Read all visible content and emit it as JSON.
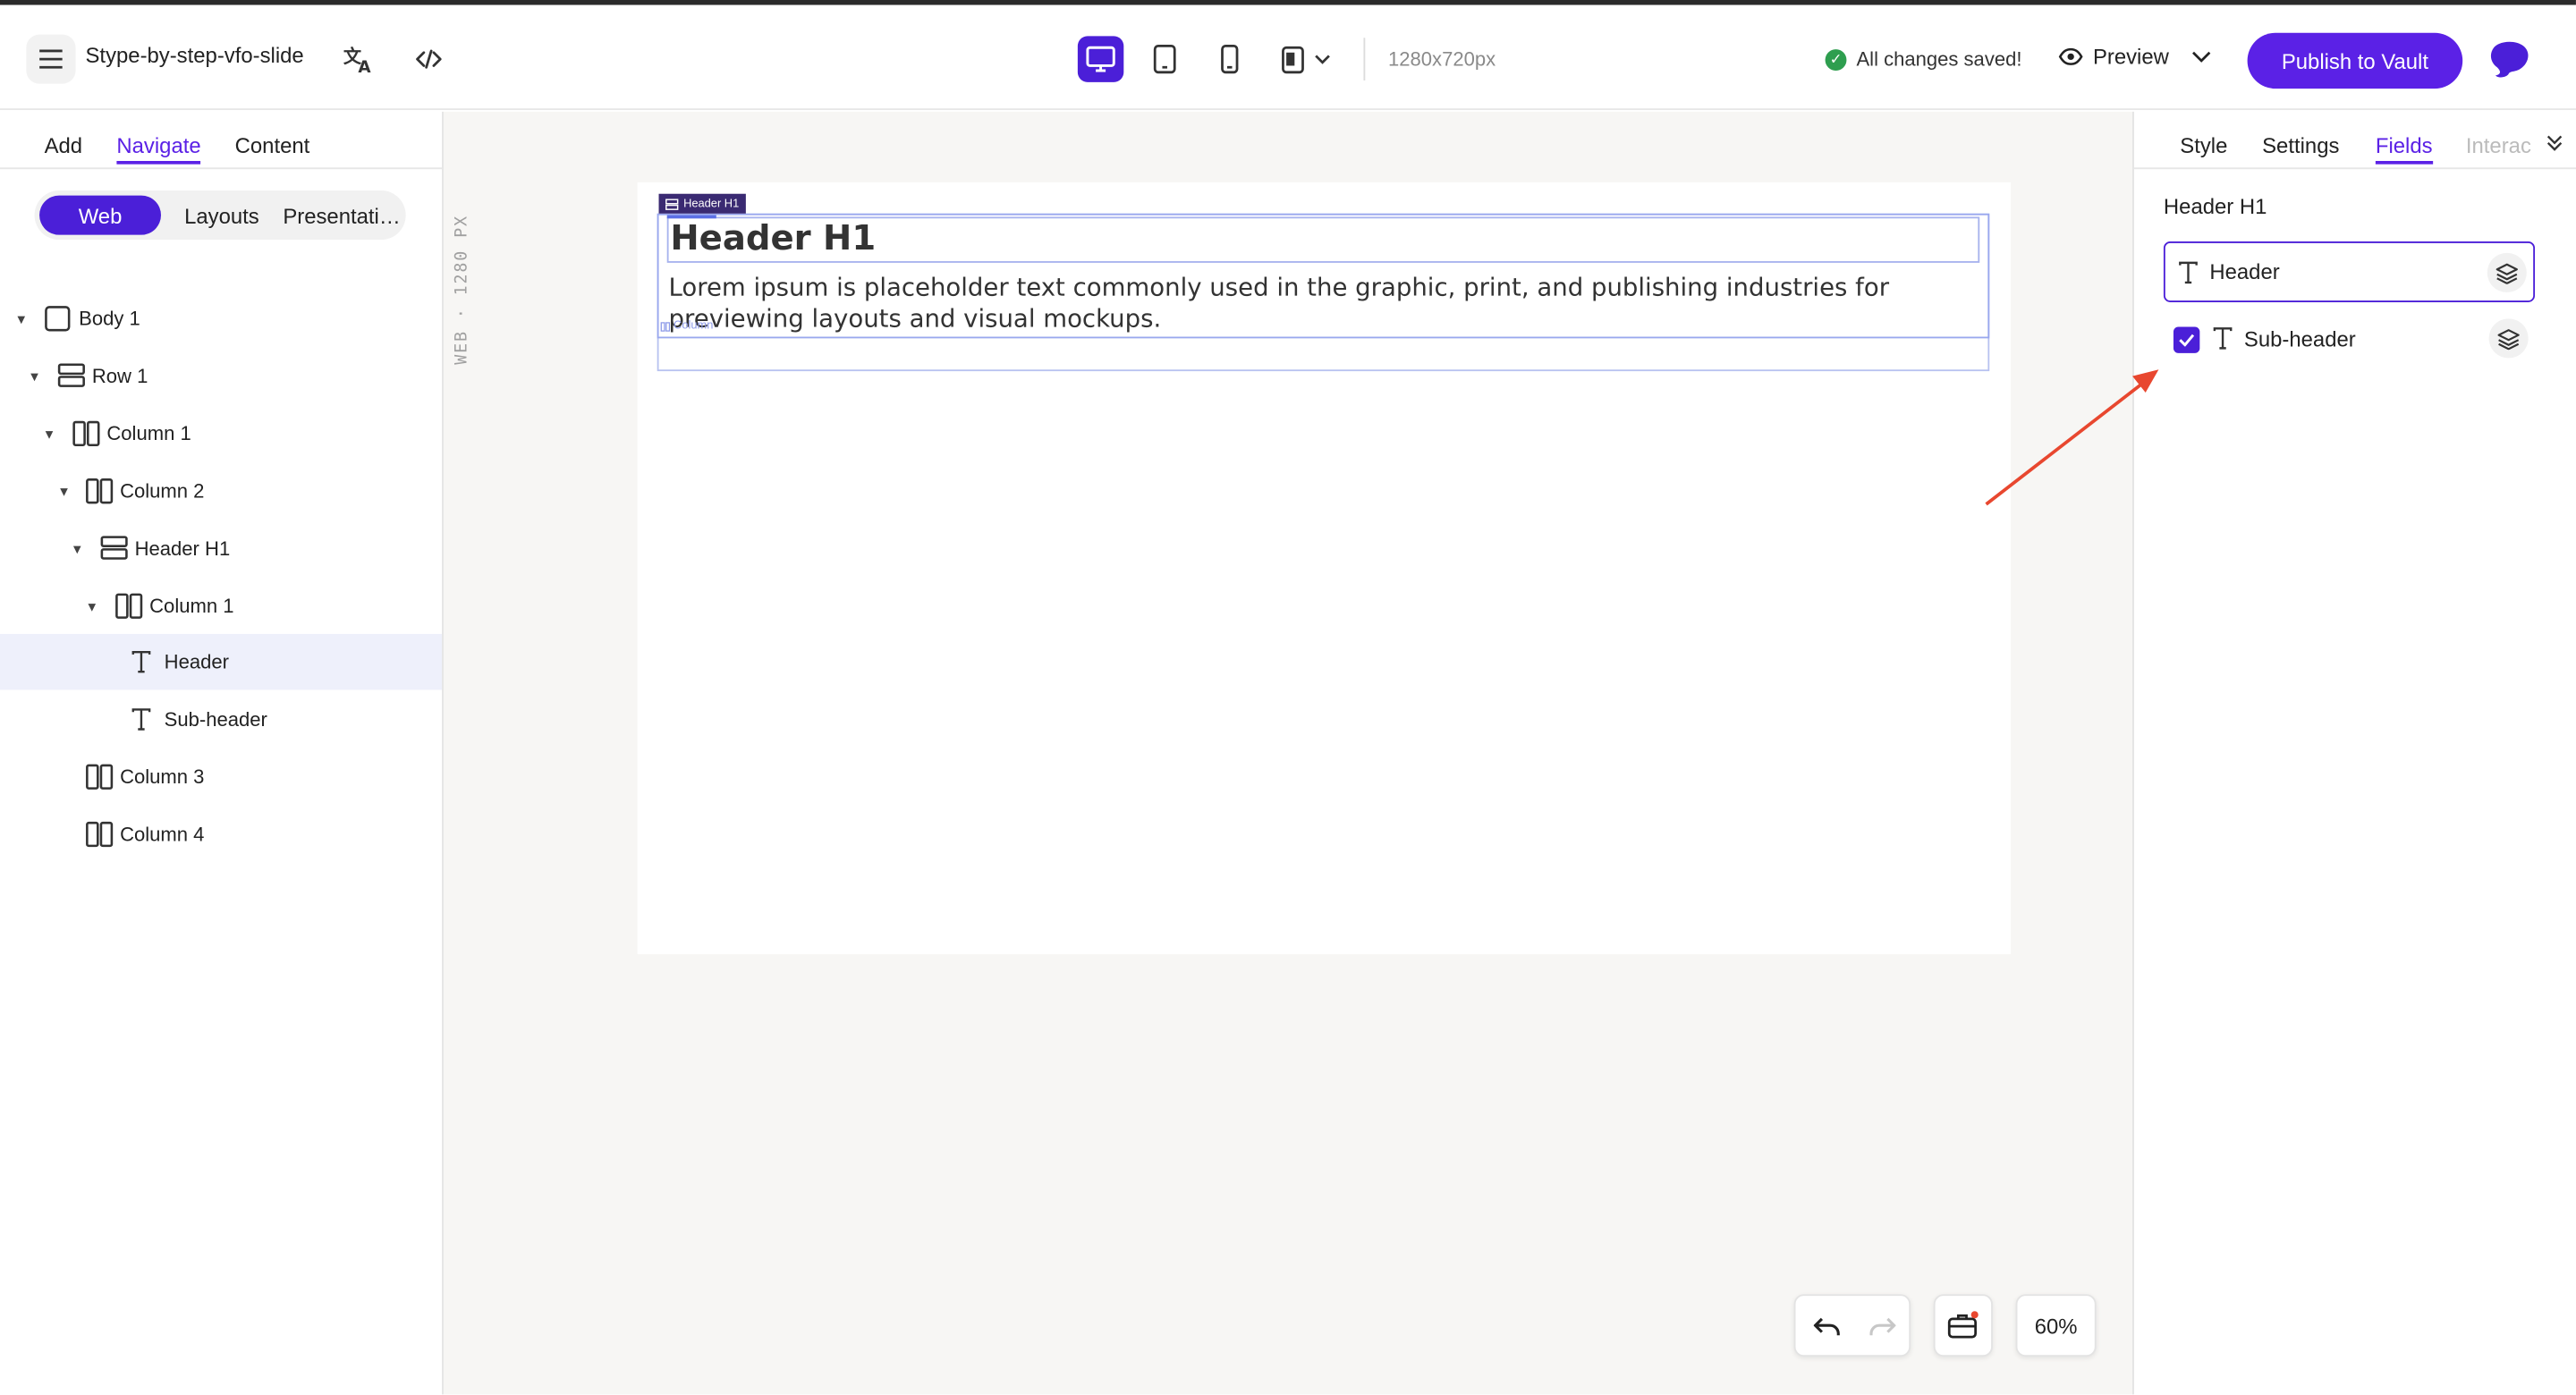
{
  "topbar": {
    "project_name": "Stype-by-step-vfo-slide",
    "resolution": "1280x720px",
    "saved_status": "All changes saved!",
    "preview_label": "Preview",
    "publish_label": "Publish to Vault"
  },
  "left_panel": {
    "tabs": [
      {
        "label": "Add"
      },
      {
        "label": "Navigate",
        "active": true
      },
      {
        "label": "Content"
      }
    ],
    "segments": [
      {
        "label": "Web",
        "active": true
      },
      {
        "label": "Layouts"
      },
      {
        "label": "Presentati…"
      }
    ],
    "tree": [
      {
        "label": "Body 1",
        "icon": "square-icon",
        "depth": 0,
        "expanded": true
      },
      {
        "label": "Row 1",
        "icon": "row-icon",
        "depth": 1,
        "expanded": true
      },
      {
        "label": "Column 1",
        "icon": "column-icon",
        "depth": 2,
        "expanded": true
      },
      {
        "label": "Column 2",
        "icon": "column-icon",
        "depth": 3,
        "expanded": true
      },
      {
        "label": "Header H1",
        "icon": "row-icon",
        "depth": 4,
        "expanded": true
      },
      {
        "label": "Column 1",
        "icon": "column-icon",
        "depth": 5,
        "expanded": true
      },
      {
        "label": "Header",
        "icon": "text-icon",
        "depth": 6,
        "selected": true
      },
      {
        "label": "Sub-header",
        "icon": "text-icon",
        "depth": 6
      },
      {
        "label": "Column 3",
        "icon": "column-icon",
        "depth": 3
      },
      {
        "label": "Column 4",
        "icon": "column-icon",
        "depth": 3
      }
    ]
  },
  "canvas": {
    "ruler_label": "WEB · 1280 PX",
    "selection_tag": "Header H1",
    "column_tag": "Column",
    "slide_header": "Header H1",
    "slide_subheader": "Lorem ipsum is placeholder text commonly used in the graphic, print, and publishing industries for previewing layouts and visual mockups.",
    "zoom": "60%"
  },
  "right_panel": {
    "tabs": [
      {
        "label": "Style"
      },
      {
        "label": "Settings"
      },
      {
        "label": "Fields",
        "active": true
      },
      {
        "label": "Interac"
      }
    ],
    "title": "Header H1",
    "fields": [
      {
        "label": "Header",
        "checked": false,
        "active": true
      },
      {
        "label": "Sub-header",
        "checked": true
      }
    ]
  },
  "colors": {
    "accent": "#5b21e6",
    "annotation_arrow": "#e8472f",
    "saved_green": "#2e9e4f"
  }
}
